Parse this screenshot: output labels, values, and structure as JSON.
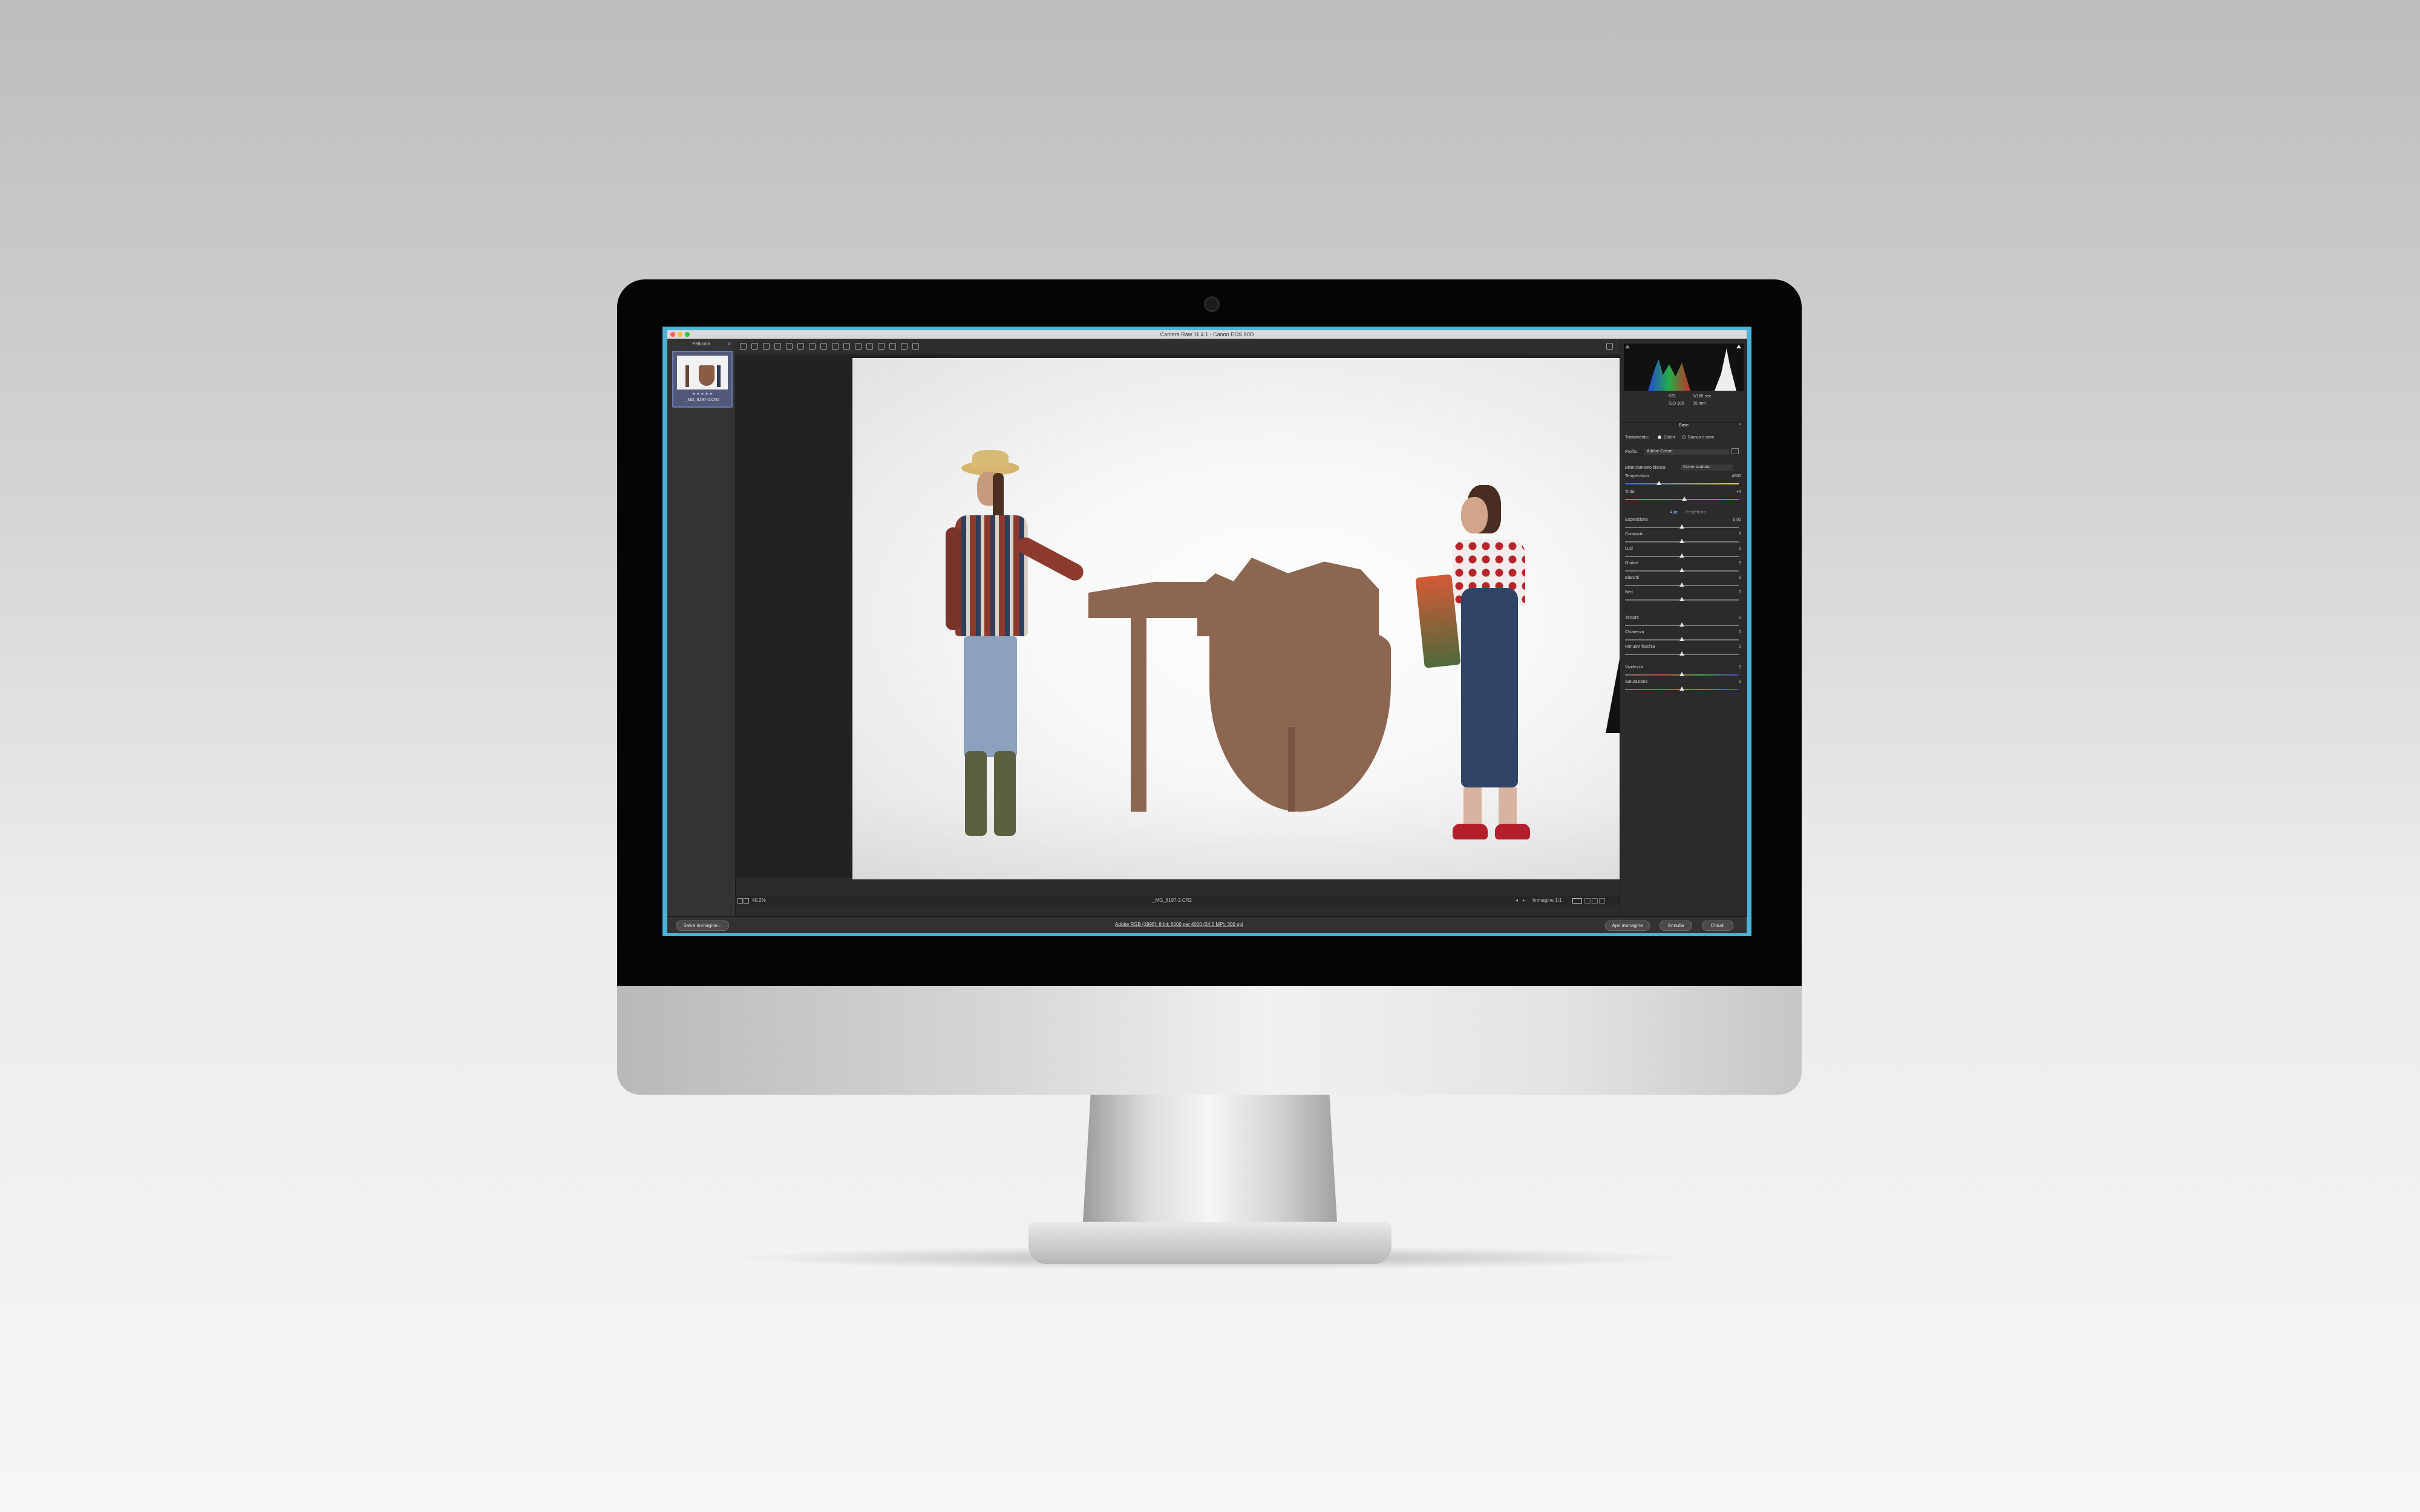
{
  "titlebar": {
    "title": "Camera Raw 11.4.1 - Canon EOS 80D"
  },
  "filmstrip": {
    "header": "Pellicola",
    "thumbnail": {
      "caption": "_MG_8197-2.CR2",
      "stars": "★ ★ ★ ★ ★"
    }
  },
  "toolbar": {
    "tools": [
      "zoom-icon",
      "hand-icon",
      "white-balance-icon",
      "color-sampler-icon",
      "target-adjustment-icon",
      "crop-icon",
      "straighten-icon",
      "transform-icon",
      "spot-removal-icon",
      "red-eye-icon",
      "adjustment-brush-icon",
      "graduated-filter-icon",
      "radial-filter-icon",
      "preferences-icon",
      "rotate-left-icon",
      "rotate-right-icon"
    ],
    "fullscreen_icon": "fullscreen-icon"
  },
  "statusbar": {
    "zoom": "40,2%",
    "filename": "_MG_8197-2.CR2",
    "image_counter": "Immagine 1/1"
  },
  "panel": {
    "camera_info": {
      "f": "f/22",
      "shutter": "1/160 sec",
      "iso": "ISO 100",
      "focal": "35 mm"
    },
    "section_title": "Base",
    "treatment": {
      "label": "Trattamento:",
      "colors": "Colori",
      "bw": "Bianco e nero"
    },
    "profile": {
      "label": "Profilo:",
      "value": "Adobe Colore"
    },
    "wb": {
      "label": "Bilanciamento bianco:",
      "value": "Come scattato"
    },
    "sliders_top": [
      {
        "label": "Temperatura",
        "value": "4800",
        "pos": 0.3,
        "track": "temp"
      },
      {
        "label": "Tinta",
        "value": "+4",
        "pos": 0.52,
        "track": "tint"
      }
    ],
    "auto": {
      "auto": "Auto",
      "default": "Predefinito"
    },
    "sliders_tone": [
      {
        "label": "Esposizione",
        "value": "0,00",
        "pos": 0.5
      },
      {
        "label": "Contrasto",
        "value": "0",
        "pos": 0.5
      },
      {
        "label": "Luci",
        "value": "0",
        "pos": 0.5
      },
      {
        "label": "Ombre",
        "value": "0",
        "pos": 0.5
      },
      {
        "label": "Bianchi",
        "value": "0",
        "pos": 0.5
      },
      {
        "label": "Neri",
        "value": "0",
        "pos": 0.5
      }
    ],
    "sliders_presence": [
      {
        "label": "Texture",
        "value": "0",
        "pos": 0.5
      },
      {
        "label": "Chiarezza",
        "value": "0",
        "pos": 0.5
      },
      {
        "label": "Rimuovi foschia",
        "value": "0",
        "pos": 0.5
      }
    ],
    "sliders_color": [
      {
        "label": "Vividezza",
        "value": "0",
        "pos": 0.5
      },
      {
        "label": "Saturazione",
        "value": "0",
        "pos": 0.5
      }
    ]
  },
  "bottombar": {
    "save_label": "Salva immagine...",
    "workflow_link": "Adobe RGB (1998); 8 bit; 6000 per 4000 (24,0 MP); 300 ppi",
    "open_label": "Apri immagine",
    "cancel_label": "Annulla",
    "done_label": "Chiudi"
  }
}
